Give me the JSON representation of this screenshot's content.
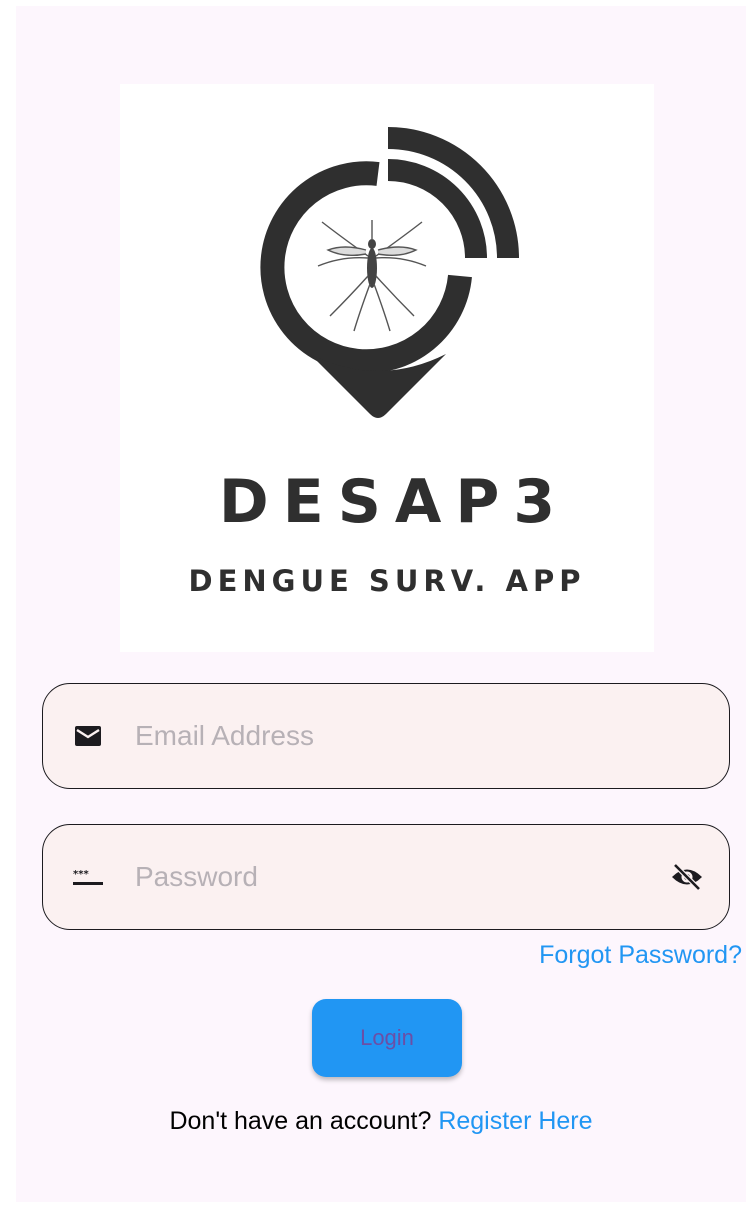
{
  "logo": {
    "icon": "mosquito-location-pin-icon",
    "brand_name": "DESAP3",
    "tagline": "DENGUE SURV. APP"
  },
  "form": {
    "email": {
      "icon": "mail-icon",
      "placeholder": "Email Address",
      "value": ""
    },
    "password": {
      "icon": "password-icon",
      "placeholder": "Password",
      "value": "",
      "toggle_icon": "eye-off-icon"
    },
    "forgot_label": "Forgot Password?",
    "login_label": "Login",
    "register_prompt": "Don't have an account?",
    "register_link": "Register Here"
  },
  "colors": {
    "accent": "#2196f3",
    "background": "#fdf6fd",
    "field_fill": "#fbf1f1",
    "logo_dark": "#2f2f2f"
  }
}
